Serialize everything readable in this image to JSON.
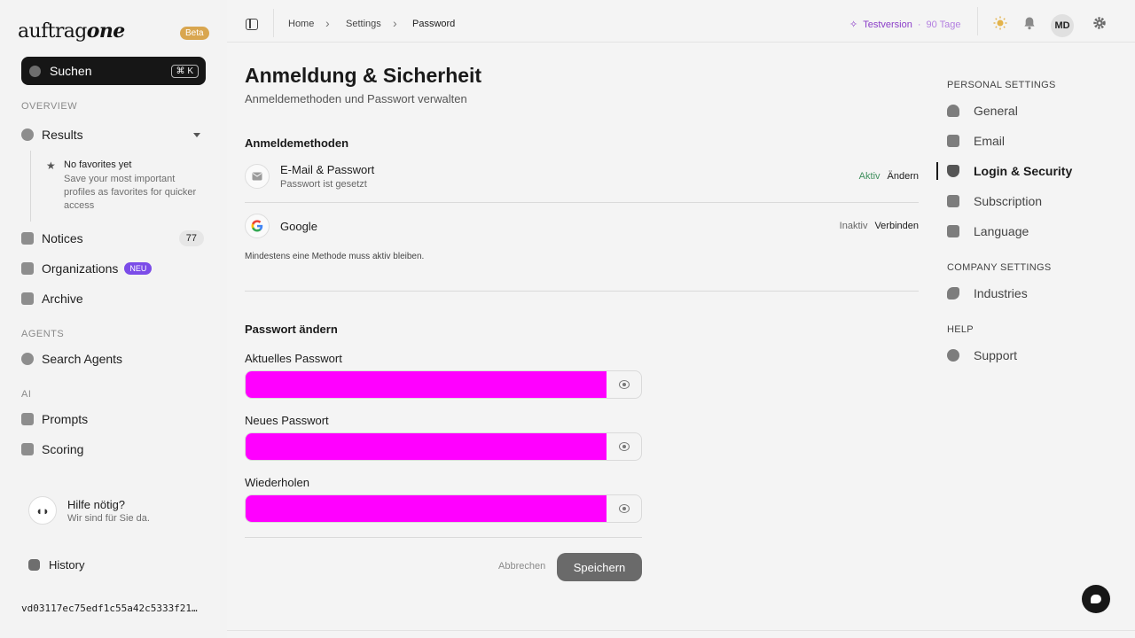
{
  "app": {
    "logo_main": "auftrag",
    "logo_accent": "one",
    "beta_badge": "Beta"
  },
  "sidebar": {
    "search": {
      "label": "Suchen",
      "shortcut": "⌘ K"
    },
    "sections": {
      "overview": "OVERVIEW",
      "agents": "AGENTS",
      "ai": "AI"
    },
    "results": {
      "label": "Results"
    },
    "favorites": {
      "title": "No favorites yet",
      "description": "Save your most important profiles as favorites for quicker access"
    },
    "notices": {
      "label": "Notices",
      "count": "77"
    },
    "organizations": {
      "label": "Organizations",
      "badge": "NEU"
    },
    "archive": {
      "label": "Archive"
    },
    "search_agents": {
      "label": "Search Agents"
    },
    "prompts": {
      "label": "Prompts"
    },
    "scoring": {
      "label": "Scoring"
    },
    "help": {
      "title": "Hilfe nötig?",
      "subtitle": "Wir sind für Sie da."
    },
    "history": {
      "label": "History"
    },
    "hash": "vd03117ec75edf1c55a42c5333f21…"
  },
  "topbar": {
    "breadcrumbs": [
      "Home",
      "Settings",
      "Password"
    ],
    "trial_label": "Testversion",
    "trial_sep": "·",
    "trial_days": "90 Tage",
    "avatar": "MD"
  },
  "page": {
    "title": "Anmeldung & Sicherheit",
    "subtitle": "Anmeldemethoden und Passwort verwalten",
    "methods_heading": "Anmeldemethoden",
    "methods": [
      {
        "title": "E-Mail & Passwort",
        "subtitle": "Passwort ist gesetzt",
        "status": "Aktiv",
        "action": "Ändern"
      },
      {
        "title": "Google",
        "status": "Inaktiv",
        "action": "Verbinden"
      }
    ],
    "methods_note": "Mindestens eine Methode muss aktiv bleiben.",
    "password_heading": "Passwort ändern",
    "fields": [
      {
        "label": "Aktuelles Passwort"
      },
      {
        "label": "Neues Passwort"
      },
      {
        "label": "Wiederholen"
      }
    ],
    "cancel_label": "Abbrechen",
    "save_label": "Speichern"
  },
  "settings_nav": {
    "personal_heading": "PERSONAL SETTINGS",
    "personal": [
      "General",
      "Email",
      "Login & Security",
      "Subscription",
      "Language"
    ],
    "company_heading": "COMPANY SETTINGS",
    "company": [
      "Industries"
    ],
    "help_heading": "HELP",
    "help": [
      "Support"
    ]
  },
  "colors": {
    "accent_trial": "#8b3ec8",
    "active_status": "#3f8f5d",
    "neu_badge": "#7b4ce8",
    "beta_badge": "#d9a64f",
    "redacted_field": "#ff00ff"
  }
}
